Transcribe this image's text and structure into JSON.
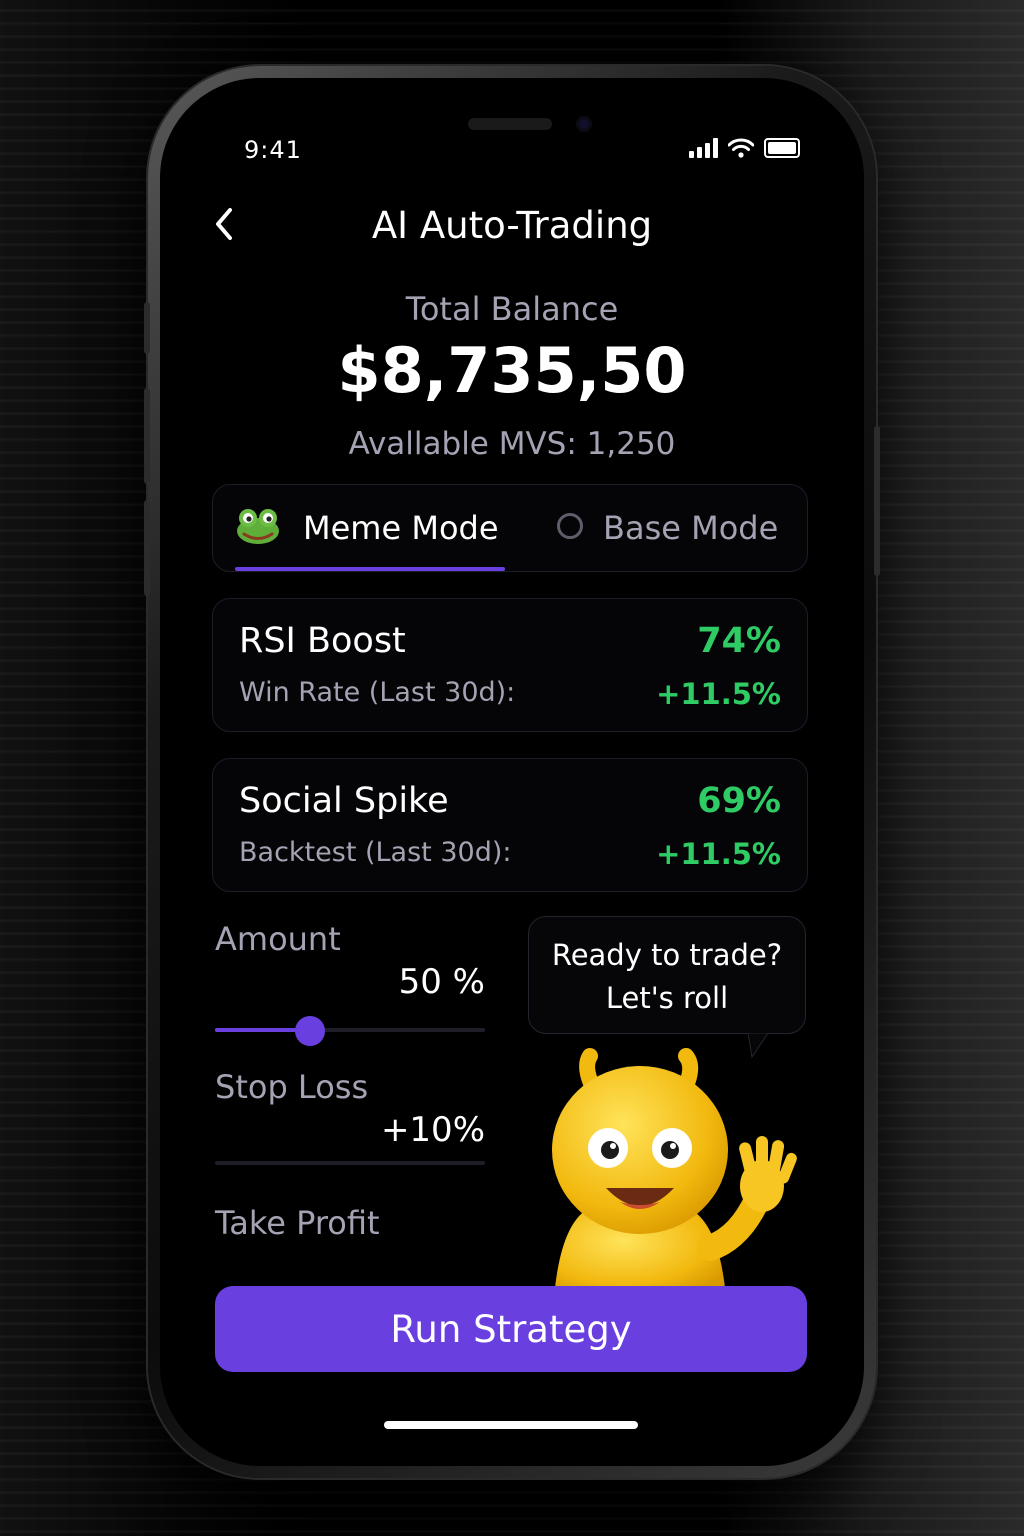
{
  "status_bar": {
    "time": "9:41"
  },
  "header": {
    "title": "AI Auto-Trading"
  },
  "balance": {
    "label": "Total Balance",
    "value": "$8,735,50",
    "available": "Avallable MVS: 1,250"
  },
  "modes": {
    "meme_label": "Meme Mode",
    "base_label": "Base Mode",
    "selected": "Meme Mode"
  },
  "strategies": [
    {
      "name": "RSI Boost",
      "subtitle": "Win Rate (Last 30d):",
      "percent": "74%",
      "change": "+11.5%"
    },
    {
      "name": "Social Spike",
      "subtitle": "Backtest (Last 30d):",
      "percent": "69%",
      "change": "+11.5%"
    }
  ],
  "controls": {
    "amount_label": "Amount",
    "amount_value": "50 %",
    "amount_level": 0.35,
    "stop_loss_label": "Stop Loss",
    "stop_loss_value": "+10%",
    "take_profit_label": "Take Profit"
  },
  "mascot": {
    "line1": "Ready to trade?",
    "line2": "Let's roll"
  },
  "run_button": {
    "label": "Run Strategy"
  },
  "colors": {
    "accent": "#6a3fe0",
    "positive": "#2fcc65",
    "muted_text": "#a3a3b3",
    "background": "#000000"
  },
  "icons": {
    "back": "chevron-left-icon",
    "meme_mode": "frog-icon",
    "base_mode": "radio-icon",
    "signal": "cellular-signal-icon",
    "wifi": "wifi-icon",
    "battery": "battery-icon"
  }
}
